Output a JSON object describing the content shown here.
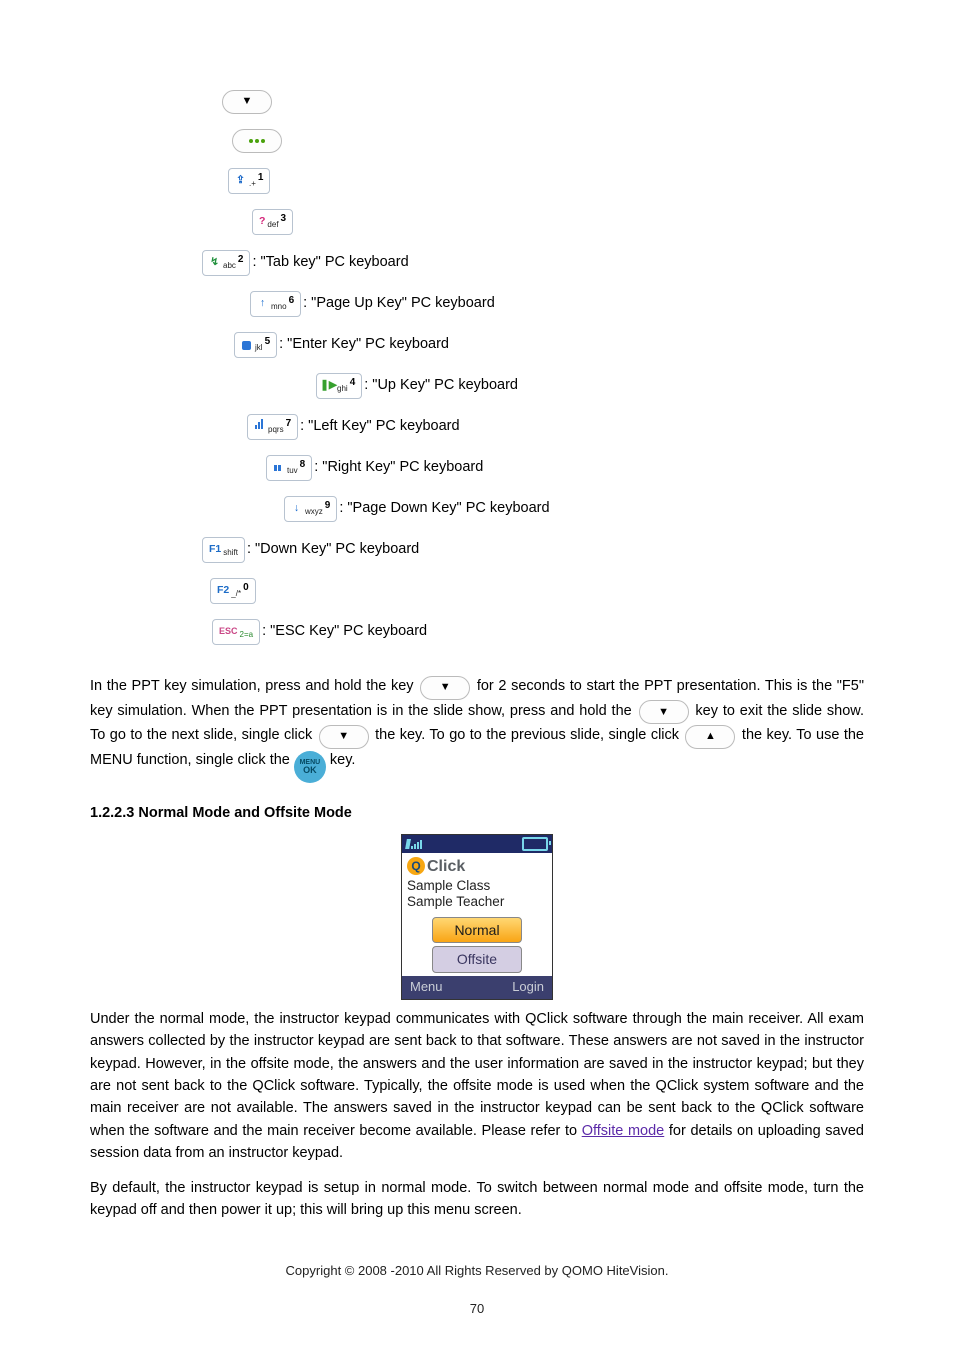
{
  "keypresses": {
    "kQuestion": "?",
    "kF1": "F1",
    "kF2": "F2",
    "kESC": "ESC",
    "sub_shift": "shift",
    "sub_def": "def",
    "sub_abc": "abc",
    "sub_mno": "mno",
    "sub_jkl": "jkl",
    "sub_ghi": "ghi",
    "sub_pqrs": "pqrs",
    "sub_tuv": "tuv",
    "sub_wxyz": "wxyz",
    "sub_2na": "2=a",
    "sub_punct": "_/*",
    "sup0": "0",
    "sup1": "1",
    "sup2": "2",
    "sup3": "3",
    "sup4": "4",
    "sup5": "5",
    "sup6": "6",
    "sup7": "7",
    "sup8": "8",
    "sup9": "9",
    "tri_down": "▼",
    "tri_up": "▲",
    "menu": "MENU",
    "ok": "OK"
  },
  "descriptions": {
    "tab": " : \"Tab key\" PC keyboard",
    "pageup": " : \"Page Up Key\" PC keyboard",
    "enter": " : \"Enter Key\" PC keyboard",
    "up": " : \"Up Key\" PC keyboard",
    "left": " : \"Left Key\" PC keyboard",
    "right": " : \"Right Key\" PC keyboard",
    "pagedown": " : \"Page Down Key\" PC keyboard",
    "down": " : \"Down Key\" PC keyboard",
    "esc": " : \"ESC Key\" PC keyboard"
  },
  "paragraphs": {
    "p1_a": "In the PPT key simulation, press and hold the key ",
    "p1_b": " for 2 seconds to start the PPT presentation. This is the \"F5\" key simulation. When the PPT presentation is in the slide show, press and hold the ",
    "p1_c": " key to exit the slide show. To go to the next slide, single click",
    "p1_d": " the key. To go to the previous slide, single click ",
    "p1_e": " the key. To use the MENU function, single click the ",
    "p1_f": " key.",
    "heading": "1.2.2.3 Normal Mode and Offsite Mode",
    "p2": "Under the normal mode, the instructor keypad communicates with QClick software through the main receiver. All exam answers collected by the instructor keypad are sent back to that software. These answers are not saved in the instructor keypad. However, in the offsite mode, the answers and the user information are saved in the instructor keypad; but they are not sent back to the QClick software. Typically, the offsite mode is used when the QClick system software and the main receiver are not available. The answers saved in the instructor keypad can be sent back to the QClick software when the software and the main receiver become available. Please refer to ",
    "p2_link": "Offsite mode",
    "p2_cont": " for details on uploading saved session data from an instructor keypad.",
    "p3": "By default, the instructor keypad is setup in normal mode. To switch between normal mode and offsite mode, turn the keypad off and then power it up; this will bring up this menu screen."
  },
  "phone": {
    "logo": "Click",
    "class": "Sample Class",
    "teacher": "Sample Teacher",
    "btn_normal": "Normal",
    "btn_offsite": "Offsite",
    "soft_menu": "Menu",
    "soft_login": "Login"
  },
  "footer": {
    "copyright": "Copyright © 2008 -2010 All Rights Reserved by QOMO HiteVision.",
    "page": "70"
  }
}
